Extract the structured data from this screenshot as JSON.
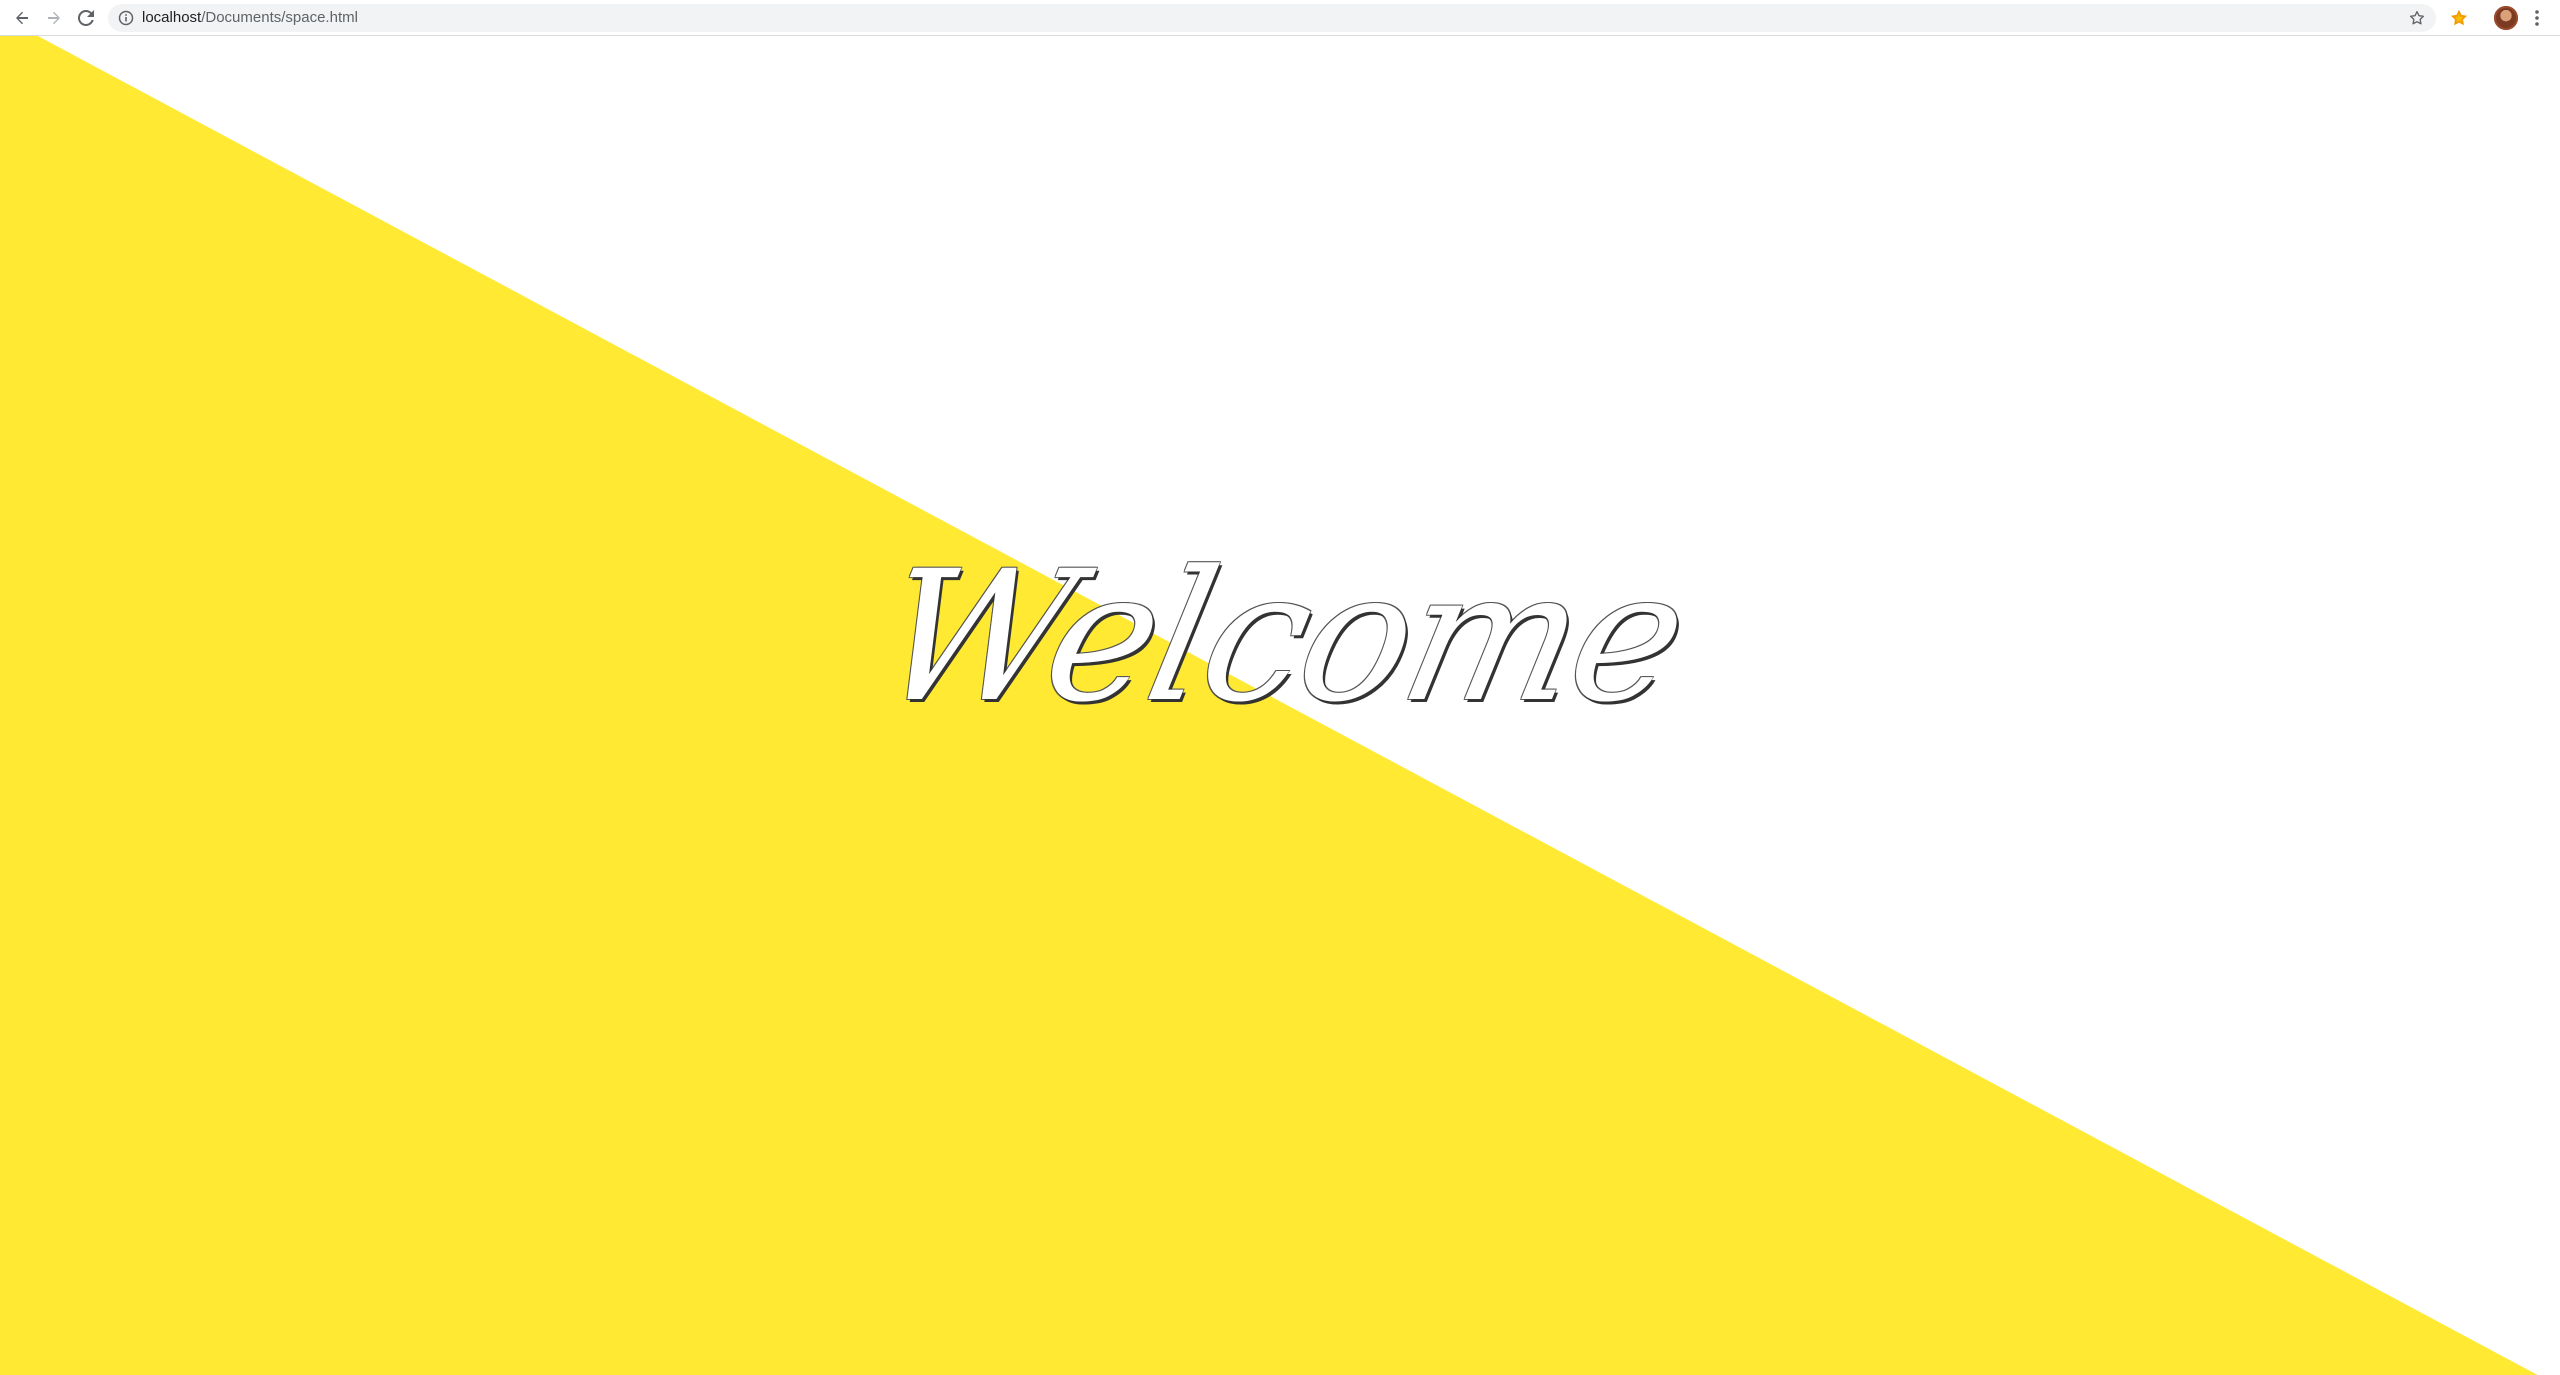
{
  "browser": {
    "url_host": "localhost",
    "url_path": "/Documents/space.html",
    "icons": {
      "back": "arrow-left-icon",
      "forward": "arrow-right-icon",
      "reload": "reload-icon",
      "info": "info-icon",
      "bookmark": "star-outline-icon",
      "extension": "star-filled-icon",
      "menu": "vertical-dots-icon"
    }
  },
  "page": {
    "heading": "Welcome",
    "colors": {
      "yellow": "#FFE933",
      "white": "#FFFFFF"
    }
  }
}
